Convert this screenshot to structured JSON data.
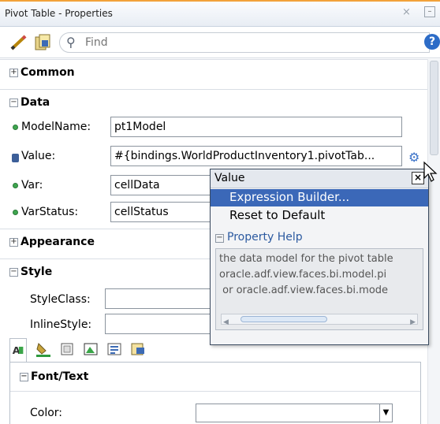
{
  "window": {
    "title": "Pivot Table - Properties",
    "close_glyph": "×",
    "minimize_glyph": "–"
  },
  "toolbar": {
    "find_placeholder": "Find",
    "help_glyph": "?"
  },
  "sections": {
    "common": {
      "label": "Common",
      "toggle": "+"
    },
    "data": {
      "label": "Data",
      "toggle": "−",
      "model_name": {
        "label": "ModelName:",
        "value": "pt1Model"
      },
      "value": {
        "label": "Value:",
        "value": "#{bindings.WorldProductInventory1.pivotTab..."
      },
      "var": {
        "label": "Var:",
        "value": "cellData"
      },
      "var_status": {
        "label": "VarStatus:",
        "value": "cellStatus"
      }
    },
    "appearance": {
      "label": "Appearance",
      "toggle": "+"
    },
    "style": {
      "label": "Style",
      "toggle": "−",
      "style_class": {
        "label": "StyleClass:",
        "value": ""
      },
      "inline_style": {
        "label": "InlineStyle:",
        "value": ""
      },
      "font_text": {
        "label": "Font/Text",
        "toggle": "−"
      },
      "color": {
        "label": "Color:",
        "value": ""
      }
    }
  },
  "popup": {
    "title": "Value",
    "close_glyph": "×",
    "items": [
      "Expression Builder...",
      "Reset to Default"
    ],
    "property_help": {
      "label": "Property Help",
      "toggle": "−",
      "lines": [
        "the data model for the pivot table",
        "oracle.adf.view.faces.bi.model.pi",
        " or oracle.adf.view.faces.bi.mode"
      ]
    }
  },
  "colors": {
    "accent": "#3b68b8",
    "title_border": "#f2a23a",
    "dot": "#3fa64f"
  }
}
